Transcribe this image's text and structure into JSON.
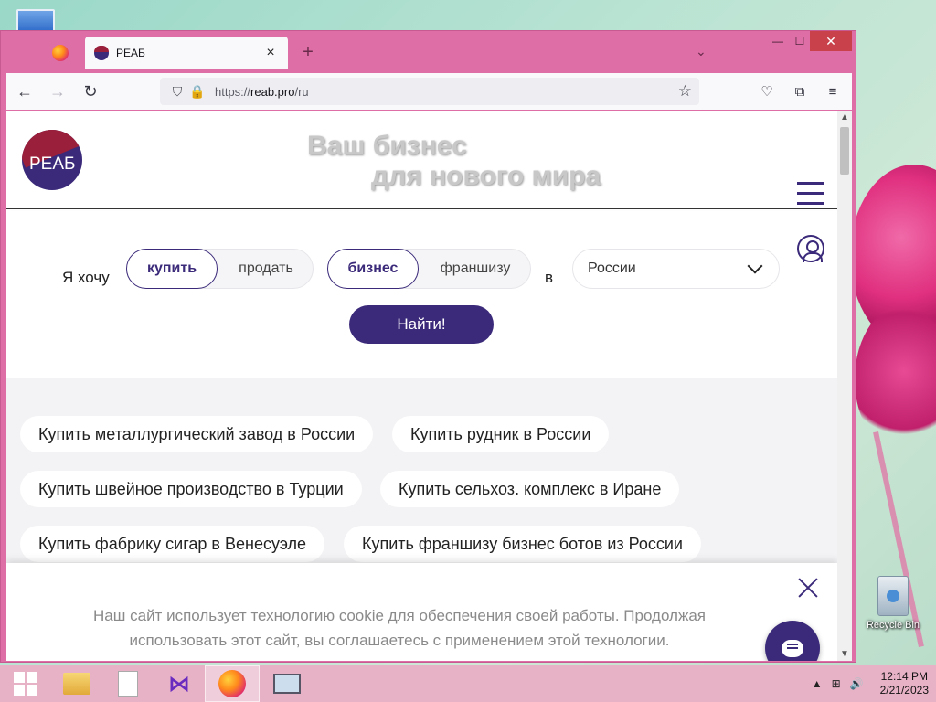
{
  "browser": {
    "tab_title": "РЕАБ",
    "tab_close": "×",
    "new_tab": "+",
    "tabs_list": "⌄",
    "url_prefix": "https://",
    "url_host": "reab.pro",
    "url_path": "/ru",
    "window_min": "—",
    "window_max": "☐",
    "window_close": "✕"
  },
  "nav": {
    "back_icon": "←",
    "forward_icon": "→",
    "reload_icon": "↻",
    "shield_icon": "⛉",
    "lock_icon": "🔒",
    "star_icon": "☆",
    "pocket_icon": "♡",
    "extensions_icon": "⧉",
    "menu_icon": "≡"
  },
  "site": {
    "logo_text": "РЕАБ",
    "tagline_line1": "Ваш бизнес",
    "tagline_line2": "для нового мира"
  },
  "search": {
    "want_label": "Я хочу",
    "action_options": [
      "купить",
      "продать"
    ],
    "action_selected": "купить",
    "type_options": [
      "бизнес",
      "франшизу"
    ],
    "type_selected": "бизнес",
    "in_label": "в",
    "country_value": "России",
    "find_button": "Найти!"
  },
  "chips": [
    "Купить металлургический завод в России",
    "Купить рудник в России",
    "Купить швейное производство в Турции",
    "Купить сельхоз. комплекс в Иране",
    "Купить фабрику сигар в Венесуэле",
    "Купить франшизу бизнес ботов из России"
  ],
  "cookie": {
    "line1": "Наш сайт использует технологию cookie для обеспечения своей работы. Продолжая",
    "line2": "использовать этот сайт, вы соглашаетесь с применением этой технологии."
  },
  "desktop": {
    "recycle_bin_label": "Recycle Bin"
  },
  "taskbar": {
    "vs_icon": "⋈",
    "tray_up": "▲",
    "tray_network": "⊞",
    "tray_volume": "🔊",
    "time": "12:14 PM",
    "date": "2/21/2023"
  },
  "colors": {
    "brand_purple": "#3b2a7a",
    "brand_red": "#9a1f3a",
    "window_frame": "#dd6ea6"
  }
}
